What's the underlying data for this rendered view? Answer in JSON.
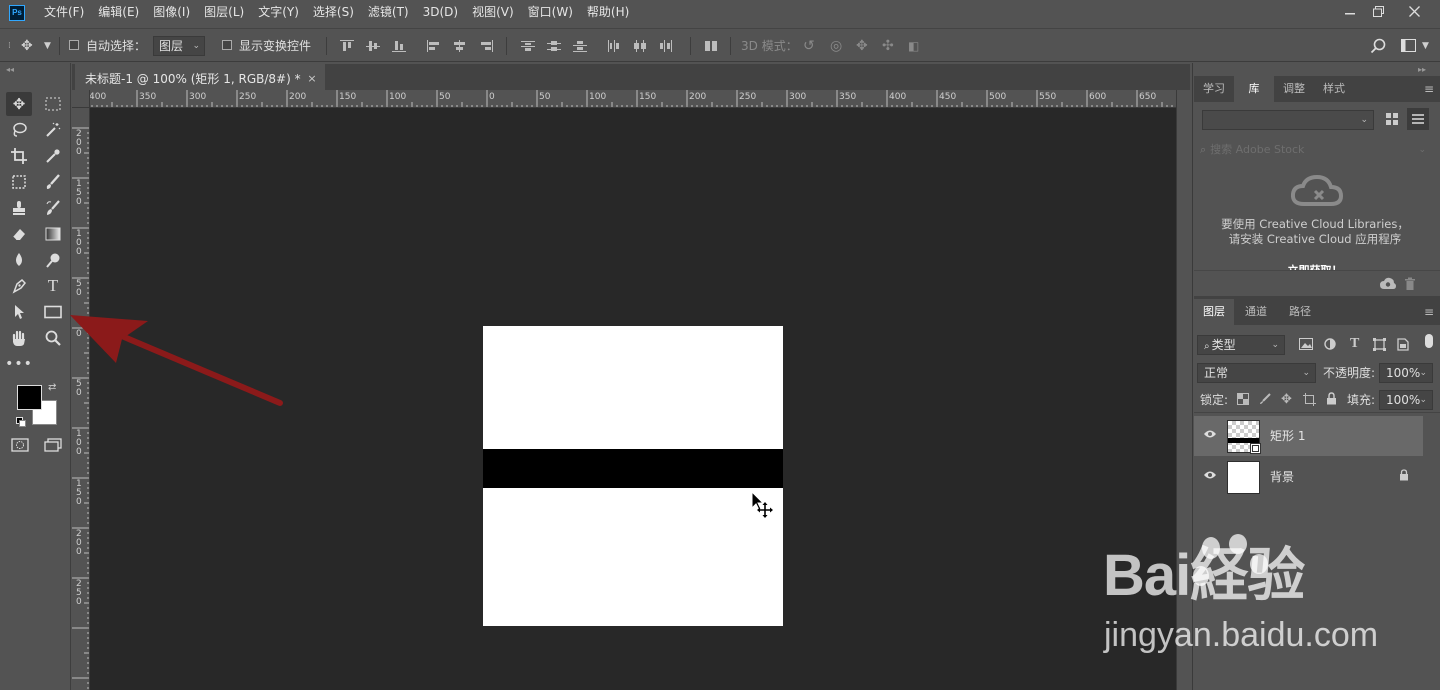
{
  "menubar": {
    "items": [
      "文件(F)",
      "编辑(E)",
      "图像(I)",
      "图层(L)",
      "文字(Y)",
      "选择(S)",
      "滤镜(T)",
      "3D(D)",
      "视图(V)",
      "窗口(W)",
      "帮助(H)"
    ],
    "app_logo": "Ps"
  },
  "optbar": {
    "auto_select_label": "自动选择：",
    "auto_select_value": "图层",
    "show_transform_label": "显示变换控件",
    "mode_3d_label": "3D 模式："
  },
  "document": {
    "tab_title": "未标题-1 @ 100% (矩形 1, RGB/8#) *",
    "close_symbol": "×",
    "ruler_top_labels": [
      "400",
      "350",
      "300",
      "250",
      "200",
      "150",
      "100",
      "50",
      "0",
      "50",
      "100",
      "150",
      "200",
      "250",
      "300",
      "350",
      "400",
      "450",
      "500",
      "550",
      "600",
      "650"
    ],
    "ruler_left_labels": [
      "200",
      "150",
      "100",
      "50",
      "0",
      "50",
      "100",
      "150",
      "200",
      "250"
    ]
  },
  "colors": {
    "foreground": "#000000",
    "background": "#ffffff",
    "canvas": "#ffffff",
    "band": "#000000",
    "arrow": "#8b1a1a"
  },
  "panels": {
    "top_tabs": [
      "学习",
      "库",
      "调整",
      "样式"
    ],
    "library": {
      "search_placeholder": "搜索 Adobe Stock",
      "message_line1": "要使用 Creative Cloud Libraries，",
      "message_line2": "请安装 Creative Cloud 应用程序",
      "link_text": "立即获取！"
    },
    "layer_tabs": [
      "图层",
      "通道",
      "路径"
    ],
    "filter_kind": "类型",
    "blend_mode": "正常",
    "opacity_label": "不透明度:",
    "opacity_value": "100%",
    "lock_label": "锁定:",
    "fill_label": "填充:",
    "fill_value": "100%",
    "layers": [
      {
        "name": "矩形 1",
        "selected": true
      },
      {
        "name": "背景",
        "locked": true
      }
    ]
  },
  "watermark": {
    "logo": "Bai経验",
    "url": "jingyan.baidu.com"
  }
}
